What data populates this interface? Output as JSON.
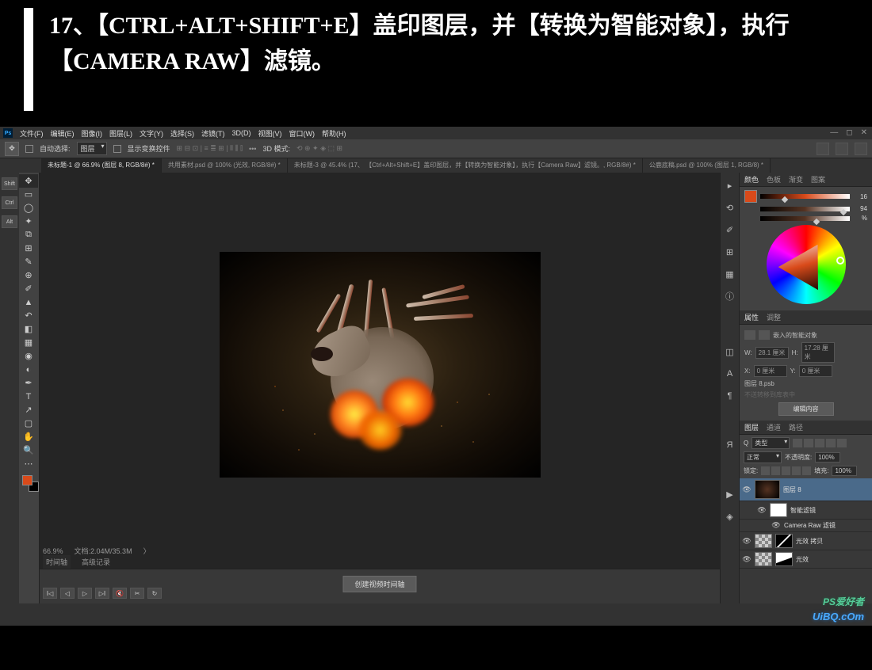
{
  "instruction": {
    "number": "17、",
    "text": "【CTRL+ALT+SHIFT+E】盖印图层，并【转换为智能对象】，执行【CAMERA RAW】滤镜。"
  },
  "menubar": [
    "文件(F)",
    "编辑(E)",
    "图像(I)",
    "图层(L)",
    "文字(Y)",
    "选择(S)",
    "滤镜(T)",
    "3D(D)",
    "视图(V)",
    "窗口(W)",
    "帮助(H)"
  ],
  "optbar": {
    "auto_select": "自动选择:",
    "layer_dd": "图层",
    "show_transform": "显示变换控件",
    "mode_label": "3D 模式:"
  },
  "tabs": [
    {
      "label": "未标题-1 @ 66.9% (图层 8, RGB/8#) *",
      "active": true
    },
    {
      "label": "共用素材.psd @ 100% (光效, RGB/8#) *",
      "active": false
    },
    {
      "label": "未标题-3 @ 45.4% (17、 【Ctrl+Alt+Shift+E】盖印图层，并【转换为智能对象】，执行【Camera Raw】滤镜。, RGB/8#) *",
      "active": false
    },
    {
      "label": "公鹿底稿.psd @ 100% (图层 1, RGB/8) *",
      "active": false
    }
  ],
  "left_buttons": [
    "Shift",
    "Ctrl",
    "Alt"
  ],
  "status": {
    "zoom": "66.9%",
    "doc": "文档:2.04M/35.3M"
  },
  "timeline": {
    "tabs": [
      "时间轴",
      "高级记录"
    ],
    "center_btn": "创建视频时间轴"
  },
  "color_panel": {
    "tabs": [
      "颜色",
      "色板",
      "渐变",
      "图案"
    ],
    "h": "16",
    "s": "94",
    "b": "%"
  },
  "properties_panel": {
    "tabs": [
      "属性",
      "调整"
    ],
    "title": "嵌入的智能对象",
    "w_label": "W:",
    "w_val": "28.1 厘米",
    "h_label": "H:",
    "h_val": "17.28 厘米",
    "x_label": "X:",
    "x_val": "0 厘米",
    "y_label": "Y:",
    "y_val": "0 厘米",
    "file": "图层 8.psb",
    "disabled_text": "不送转移到库表中",
    "edit_btn": "编辑内容"
  },
  "layers_panel": {
    "tabs": [
      "图层",
      "通道",
      "路径"
    ],
    "kind": "类型",
    "blend": "正常",
    "opacity_label": "不透明度:",
    "opacity": "100%",
    "lock_label": "锁定:",
    "fill_label": "填充:",
    "fill": "100%",
    "layers": [
      {
        "name": "图层 8",
        "selected": true,
        "thumb": "img"
      },
      {
        "name": "智能滤镜",
        "sub": true,
        "thumb": "white"
      },
      {
        "name": "Camera Raw 滤镜",
        "sub2": true
      },
      {
        "name": "光效 拷贝",
        "thumb": "mask1"
      },
      {
        "name": "光效",
        "thumb": "mask2"
      }
    ]
  },
  "watermark": {
    "line1": "PS爱好者",
    "line2": "UiBQ.cOm"
  }
}
